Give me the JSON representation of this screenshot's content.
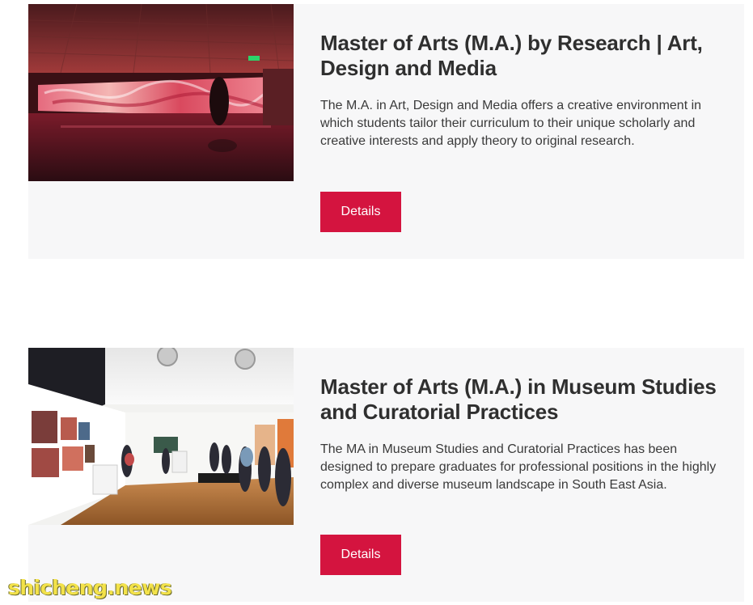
{
  "programs": [
    {
      "title": "Master of Arts (M.A.) by Research | Art, Design and Media",
      "description": "The M.A. in Art, Design and Media offers a creative environment in which students tailor their curriculum to their unique scholarly and creative interests and apply theory to original research.",
      "button_label": "Details",
      "image": "red-lit-gallery-photo"
    },
    {
      "title": "Master of Arts (M.A.) in Museum Studies and Curatorial Practices",
      "description": "The MA in Museum Studies and Curatorial Practices has been designed to prepare graduates for professional positions in the highly complex and diverse museum landscape in South East Asia.",
      "button_label": "Details",
      "image": "museum-exhibition-photo"
    }
  ],
  "watermark": "shicheng.news",
  "colors": {
    "card_background": "#f7f7f8",
    "button": "#d4143f",
    "title": "#2f2f2f"
  }
}
